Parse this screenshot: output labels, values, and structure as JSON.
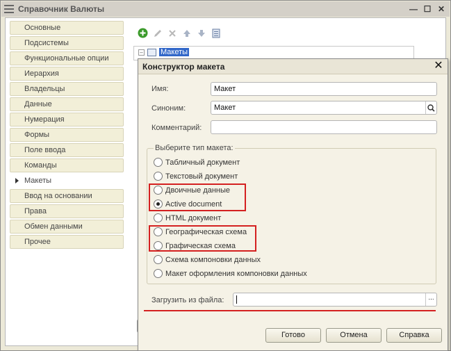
{
  "window": {
    "title": "Справочник Валюты",
    "min_icon": "minimize-icon",
    "max_icon": "maximize-icon",
    "close_icon": "close-icon"
  },
  "nav": {
    "items": [
      {
        "label": "Основные"
      },
      {
        "label": "Подсистемы"
      },
      {
        "label": "Функциональные опции"
      },
      {
        "label": "Иерархия"
      },
      {
        "label": "Владельцы"
      },
      {
        "label": "Данные"
      },
      {
        "label": "Нумерация"
      },
      {
        "label": "Формы"
      },
      {
        "label": "Поле ввода"
      },
      {
        "label": "Команды"
      },
      {
        "label": "Макеты",
        "active": true
      },
      {
        "label": "Ввод на основании"
      },
      {
        "label": "Права"
      },
      {
        "label": "Обмен данными"
      },
      {
        "label": "Прочее"
      }
    ]
  },
  "toolbar": {
    "icons": [
      "add-icon",
      "edit-icon",
      "delete-icon",
      "move-up-icon",
      "move-down-icon",
      "list-icon"
    ]
  },
  "tree": {
    "root_label": "Макеты"
  },
  "dialog": {
    "title": "Конструктор макета",
    "name_label": "Имя:",
    "name_value": "Макет",
    "synonym_label": "Синоним:",
    "synonym_value": "Макет",
    "comment_label": "Комментарий:",
    "comment_value": "",
    "type_group_label": "Выберите тип макета:",
    "types": [
      {
        "label": "Табличный документ",
        "selected": false
      },
      {
        "label": "Текстовый документ",
        "selected": false
      },
      {
        "label": "Двоичные данные",
        "selected": false
      },
      {
        "label": "Active document",
        "selected": true
      },
      {
        "label": "HTML документ",
        "selected": false
      },
      {
        "label": "Географическая схема",
        "selected": false
      },
      {
        "label": "Графическая схема",
        "selected": false
      },
      {
        "label": "Схема компоновки данных",
        "selected": false
      },
      {
        "label": "Макет оформления компоновки данных",
        "selected": false
      }
    ],
    "file_label": "Загрузить из файла:",
    "file_value": "",
    "file_button": "...",
    "ok_label": "Готово",
    "cancel_label": "Отмена",
    "help_label": "Справка"
  },
  "colors": {
    "highlight": "#d42020",
    "selection": "#3167c9"
  }
}
